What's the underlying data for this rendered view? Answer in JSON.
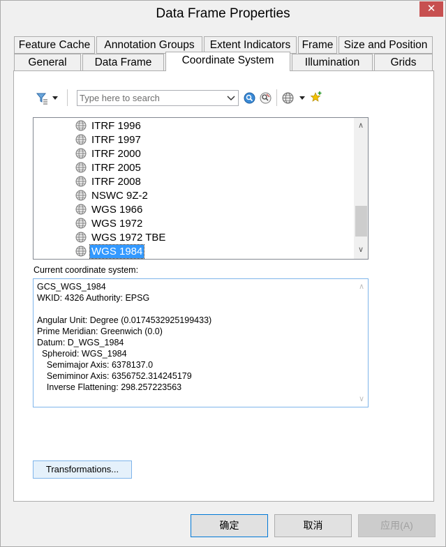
{
  "window": {
    "title": "Data Frame Properties",
    "close_glyph": "✕"
  },
  "tabs": {
    "row1": [
      "Feature Cache",
      "Annotation Groups",
      "Extent Indicators",
      "Frame",
      "Size and Position"
    ],
    "row2": [
      "General",
      "Data Frame",
      "Coordinate System",
      "Illumination",
      "Grids"
    ],
    "active": "Coordinate System"
  },
  "toolbar": {
    "search_placeholder": "Type here to search",
    "icons": [
      "filter-icon",
      "dropdown-arrow-icon",
      "search-icon",
      "clear-search-icon",
      "globe-icon",
      "dropdown-arrow-icon",
      "favorite-add-icon"
    ]
  },
  "tree": {
    "items": [
      "ITRF 1996",
      "ITRF 1997",
      "ITRF 2000",
      "ITRF 2005",
      "ITRF 2008",
      "NSWC 9Z-2",
      "WGS 1966",
      "WGS 1972",
      "WGS 1972 TBE",
      "WGS 1984"
    ],
    "selected": "WGS 1984",
    "up_arrow": "∧",
    "down_arrow": "∨"
  },
  "current": {
    "label": "Current coordinate system:",
    "lines": [
      "GCS_WGS_1984",
      "WKID: 4326 Authority: EPSG",
      "",
      "Angular Unit: Degree (0.0174532925199433)",
      "Prime Meridian: Greenwich (0.0)",
      "Datum: D_WGS_1984",
      "  Spheroid: WGS_1984",
      "    Semimajor Axis: 6378137.0",
      "    Semiminor Axis: 6356752.314245179",
      "    Inverse Flattening: 298.257223563"
    ]
  },
  "buttons": {
    "transformations": "Transformations...",
    "ok": "确定",
    "cancel": "取消",
    "apply": "应用(A)"
  },
  "colors": {
    "selection": "#3399ff",
    "close": "#c75050",
    "focus_border": "#7eb4ea"
  }
}
